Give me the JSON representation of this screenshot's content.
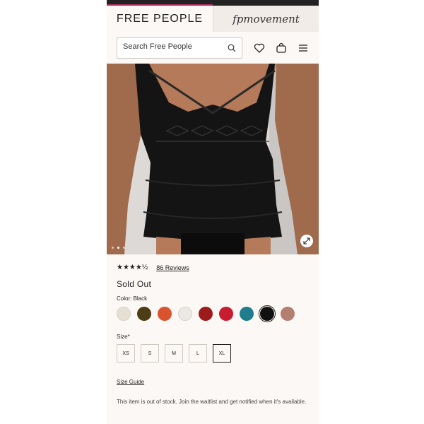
{
  "header": {
    "brand_left": "FREE PEOPLE",
    "brand_right": "fpmovement",
    "accent_color": "#b12b60"
  },
  "search": {
    "placeholder": "Search Free People"
  },
  "icons": {
    "search": "search-icon",
    "wishlist": "heart-icon",
    "bag": "shopping-bag-icon",
    "menu": "hamburger-menu-icon",
    "expand": "expand-icon"
  },
  "product": {
    "image_description": "black lace crochet halter top",
    "carousel_dots": 3,
    "carousel_active_index": 1,
    "rating_stars": 4.5,
    "stars_text": "★★★★½",
    "reviews_text": "86 Reviews",
    "status": "Sold Out",
    "color_label": "Color: Black",
    "colors": [
      {
        "name": "cream",
        "hex": "#e6dfd4"
      },
      {
        "name": "olive",
        "hex": "#4d3d14"
      },
      {
        "name": "orange",
        "hex": "#d9542e"
      },
      {
        "name": "ivory",
        "hex": "#ece8e4"
      },
      {
        "name": "red",
        "hex": "#9e1b1b"
      },
      {
        "name": "crimson",
        "hex": "#c91c2f"
      },
      {
        "name": "teal",
        "hex": "#1f7d8d"
      },
      {
        "name": "black",
        "hex": "#111111",
        "selected": true
      },
      {
        "name": "rose",
        "hex": "#b47e70"
      }
    ],
    "size_label": "Size*",
    "sizes": [
      {
        "label": "XS"
      },
      {
        "label": "S"
      },
      {
        "label": "M"
      },
      {
        "label": "L"
      },
      {
        "label": "XL",
        "selected": true
      }
    ],
    "size_guide": "Size Guide",
    "oos_message": "This item is out of stock. Join the waitlist and get notified when it's available."
  }
}
